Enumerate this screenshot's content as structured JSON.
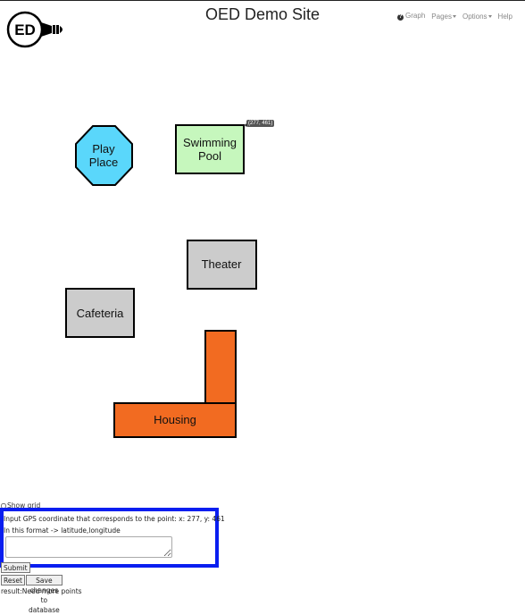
{
  "header": {
    "logo_text": "ED",
    "title": "OED Demo Site",
    "nav": [
      {
        "label": "Graph",
        "icon": "question-circle-icon"
      },
      {
        "label": "Pages",
        "dropdown": true
      },
      {
        "label": "Options",
        "dropdown": true
      },
      {
        "label": "Help"
      }
    ]
  },
  "map": {
    "shapes": [
      {
        "name": "play-place",
        "label_lines": [
          "Play",
          "Place"
        ],
        "shape": "octagon",
        "color": "#5ad7fb"
      },
      {
        "name": "swimming-pool",
        "label_lines": [
          "Swimming",
          "Pool"
        ],
        "shape": "rect",
        "color": "#c6f7bd"
      },
      {
        "name": "theater",
        "label_lines": [
          "Theater"
        ],
        "shape": "rect",
        "color": "#cccccc"
      },
      {
        "name": "cafeteria",
        "label_lines": [
          "Cafeteria"
        ],
        "shape": "rect",
        "color": "#cccccc"
      },
      {
        "name": "housing",
        "label_lines": [
          "Housing"
        ],
        "shape": "L",
        "color": "#f26b21"
      }
    ],
    "tooltip": "(277, 461)"
  },
  "controls": {
    "show_grid_label": "Show grid",
    "gps_prompt": "Input GPS coordinate that corresponds to the point: x: 277, y: 461",
    "gps_format": "In this format -> latitude,longitude",
    "gps_value": "",
    "submit_label": "Submit",
    "reset_label": "Reset",
    "save_label": "Save changes to database",
    "result_text": "result:Need more points"
  },
  "colors": {
    "highlight_border": "#0a1ef0"
  }
}
